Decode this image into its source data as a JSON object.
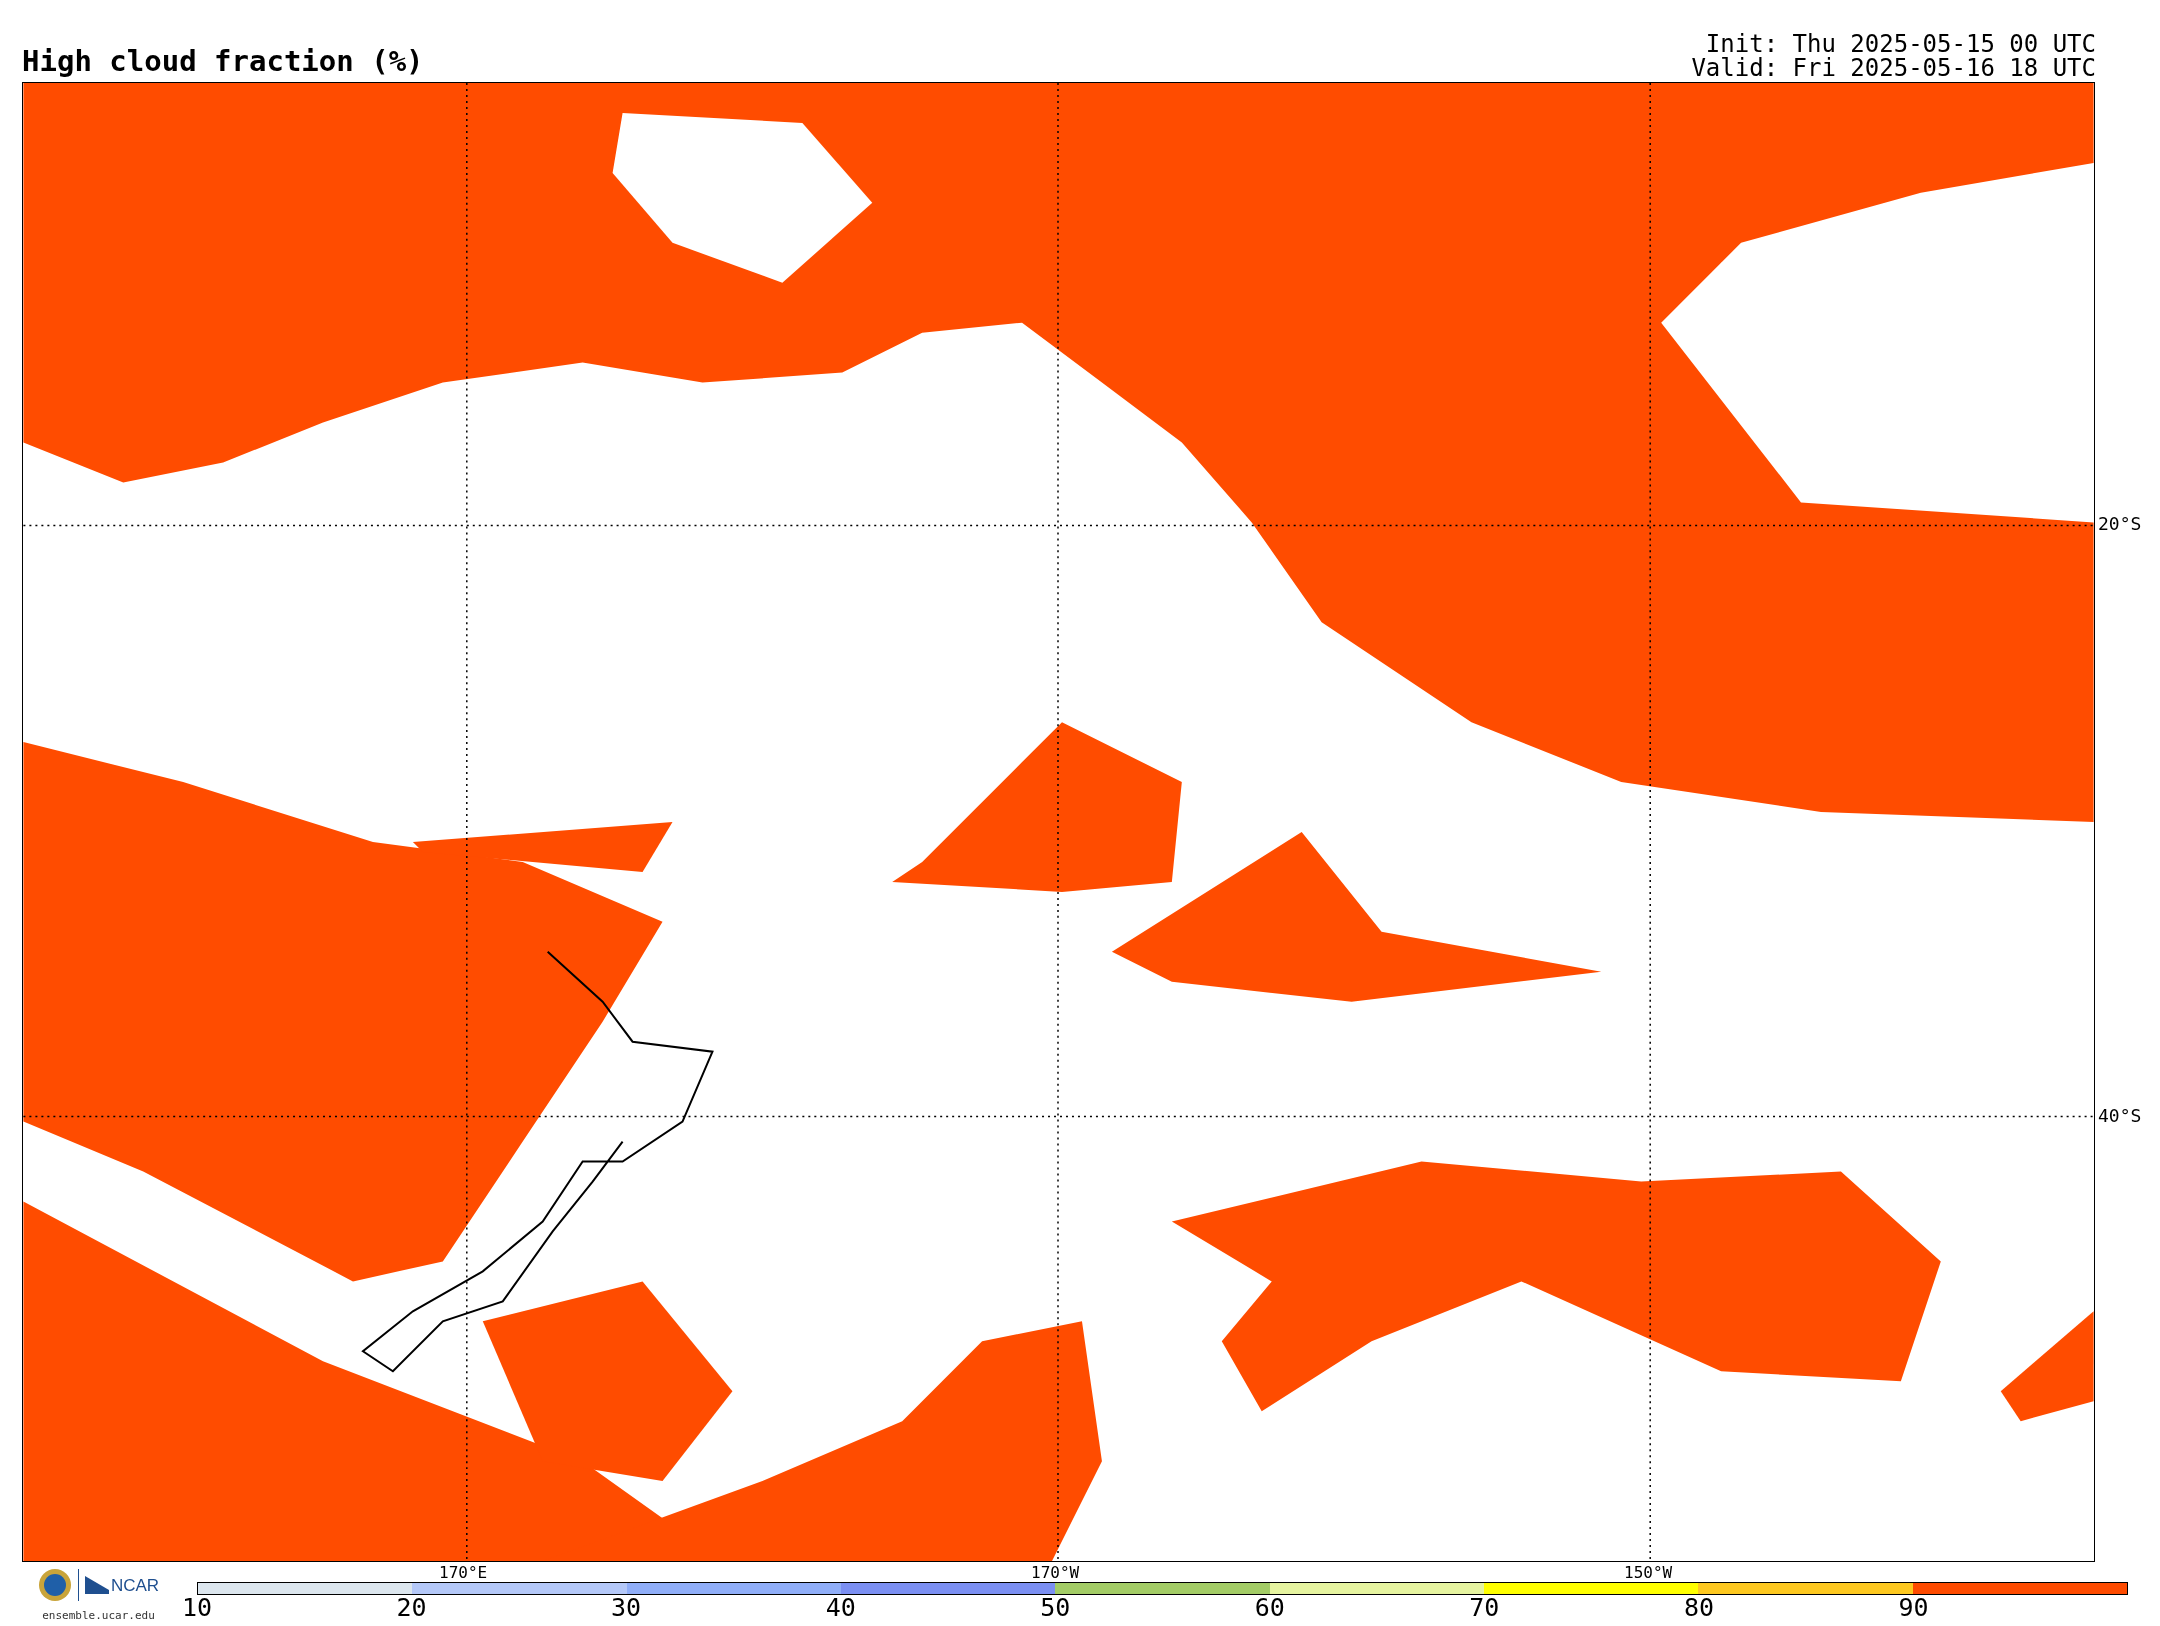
{
  "title": "High cloud fraction (%)",
  "init": "Init: Thu 2025-05-15 00 UTC",
  "valid": "Valid: Fri 2025-05-16 18 UTC",
  "map": {
    "lat_labels": [
      "20°S",
      "40°S"
    ],
    "lon_labels": [
      "170°E",
      "170°W",
      "150°W"
    ]
  },
  "logo": {
    "name": "NCAR",
    "site": "ensemble.ucar.edu"
  },
  "colorbar": [
    {
      "label": "10",
      "color": "#dce6ee"
    },
    {
      "label": "20",
      "color": "#b4c8f8"
    },
    {
      "label": "30",
      "color": "#90aef8"
    },
    {
      "label": "40",
      "color": "#7b8ff2"
    },
    {
      "label": "50",
      "color": "#a3cc66"
    },
    {
      "label": "60",
      "color": "#e6f4a0"
    },
    {
      "label": "70",
      "color": "#ffff00"
    },
    {
      "label": "80",
      "color": "#fdc820"
    },
    {
      "label": "90",
      "color": "#fe4b00"
    }
  ]
}
